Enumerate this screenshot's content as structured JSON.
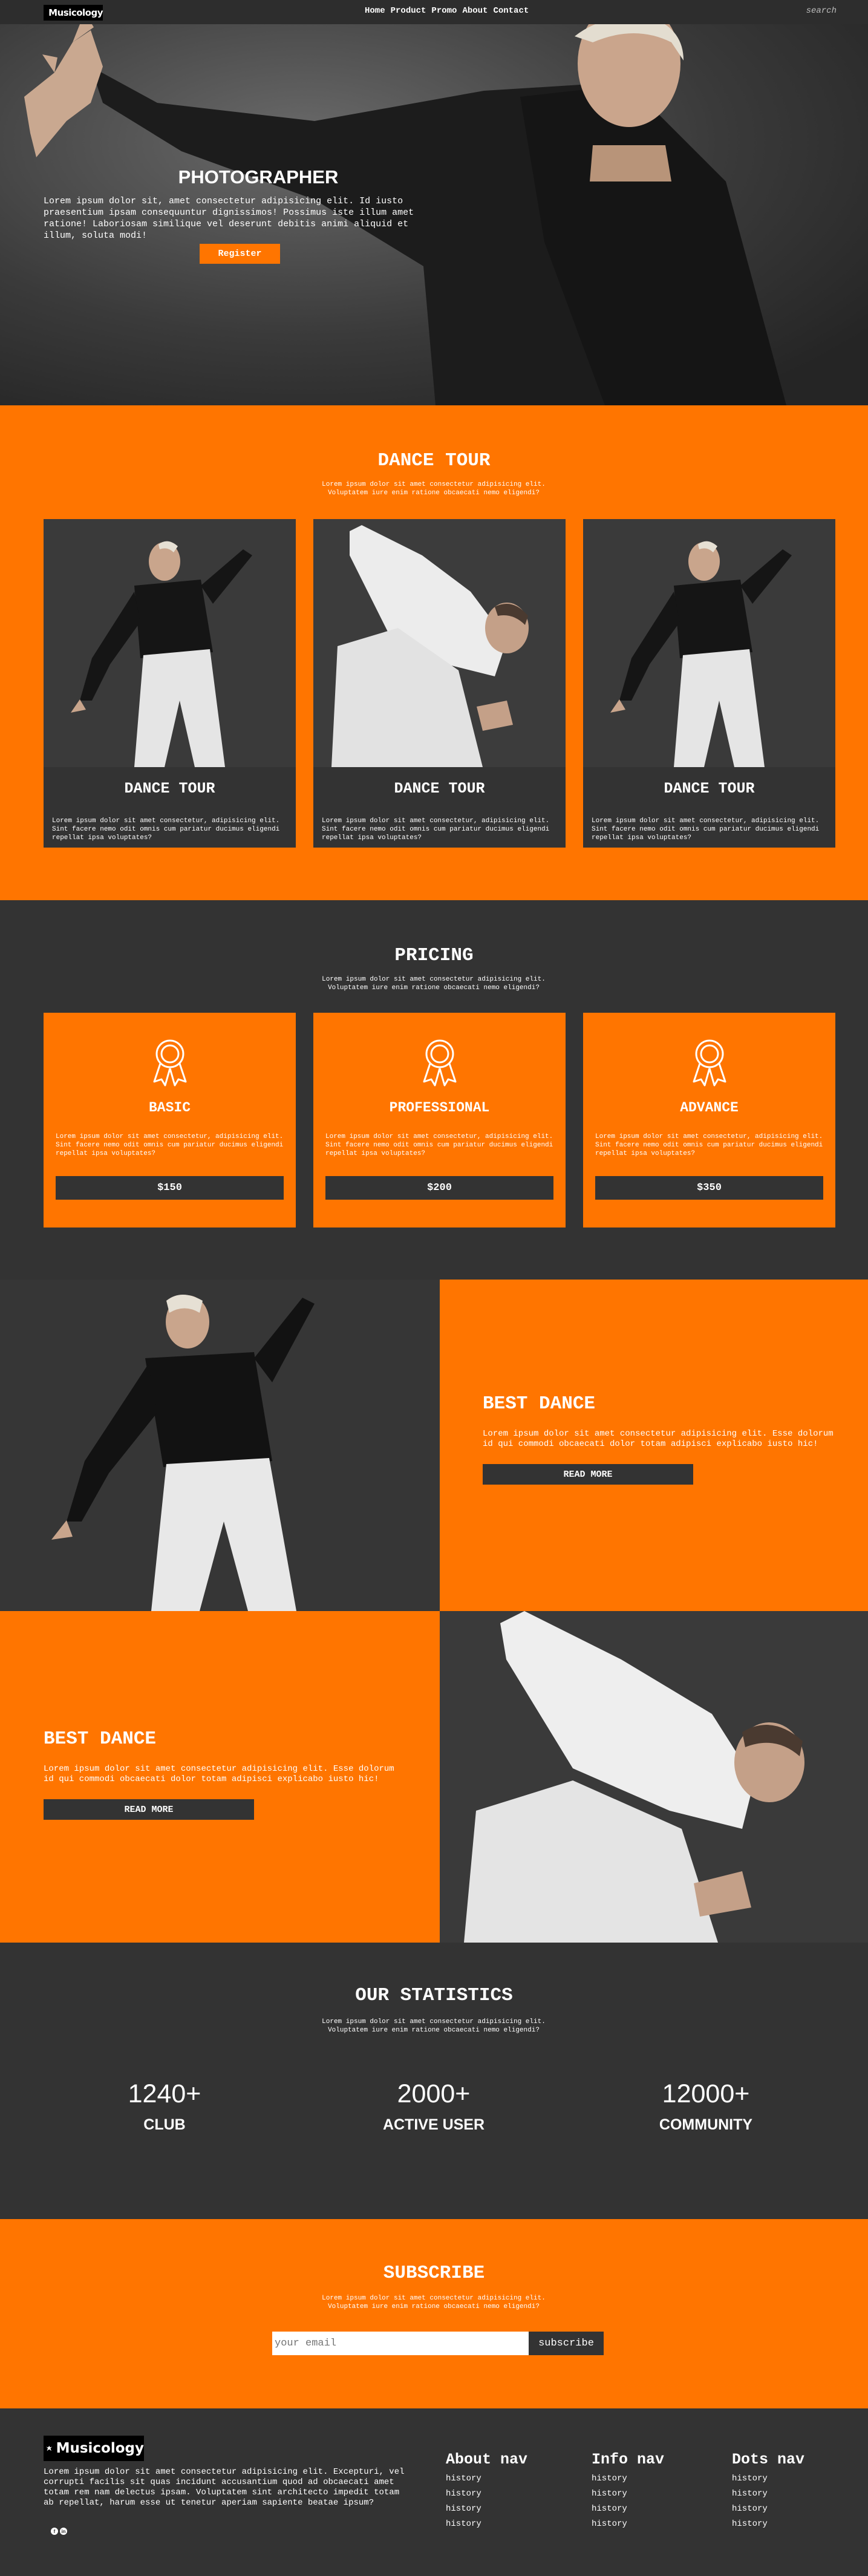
{
  "nav": {
    "logo_text": "Musicology",
    "links": [
      "Home",
      "Product",
      "Promo",
      "About",
      "Contact"
    ],
    "search": "search"
  },
  "hero": {
    "title": "PHOTOGRAPHER",
    "text": "Lorem ipsum dolor sit, amet consectetur adipisicing elit. Id iusto praesentium ipsam consequuntur dignissimos! Possimus iste illum amet ratione! Laboriosam similique vel deserunt debitis animi aliquid et illum, soluta modi!",
    "button": "Register"
  },
  "tour": {
    "title": "DANCE TOUR",
    "subtitle": "Lorem ipsum dolor sit amet consectetur adipisicing elit. Voluptatem iure enim ratione obcaecati nemo eligendi?",
    "cards": [
      {
        "title": "DANCE TOUR",
        "text": "Lorem ipsum dolor sit amet consectetur, adipisicing elit. Sint facere nemo odit omnis cum pariatur ducimus eligendi repellat ipsa voluptates?"
      },
      {
        "title": "DANCE TOUR",
        "text": "Lorem ipsum dolor sit amet consectetur, adipisicing elit. Sint facere nemo odit omnis cum pariatur ducimus eligendi repellat ipsa voluptates?"
      },
      {
        "title": "DANCE TOUR",
        "text": "Lorem ipsum dolor sit amet consectetur, adipisicing elit. Sint facere nemo odit omnis cum pariatur ducimus eligendi repellat ipsa voluptates?"
      }
    ]
  },
  "pricing": {
    "title": "PRICING",
    "subtitle": "Lorem ipsum dolor sit amet consectetur adipisicing elit. Voluptatem iure enim ratione obcaecati nemo eligendi?",
    "plans": [
      {
        "name": "BASIC",
        "text": "Lorem ipsum dolor sit amet consectetur, adipisicing elit. Sint facere nemo odit omnis cum pariatur ducimus eligendi repellat ipsa voluptates?",
        "price": "$150"
      },
      {
        "name": "PROFESSIONAL",
        "text": "Lorem ipsum dolor sit amet consectetur, adipisicing elit. Sint facere nemo odit omnis cum pariatur ducimus eligendi repellat ipsa voluptates?",
        "price": "$200"
      },
      {
        "name": "ADVANCE",
        "text": "Lorem ipsum dolor sit amet consectetur, adipisicing elit. Sint facere nemo odit omnis cum pariatur ducimus eligendi repellat ipsa voluptates?",
        "price": "$350"
      }
    ]
  },
  "features": [
    {
      "title": "BEST DANCE",
      "text": "Lorem ipsum dolor sit amet consectetur adipisicing elit. Esse dolorum id qui commodi obcaecati dolor totam adipisci explicabo iusto hic!",
      "button": "READ MORE"
    },
    {
      "title": "BEST DANCE",
      "text": "Lorem ipsum dolor sit amet consectetur adipisicing elit. Esse dolorum id qui commodi obcaecati dolor totam adipisci explicabo iusto hic!",
      "button": "READ MORE"
    }
  ],
  "stats": {
    "title": "OUR STATISTICS",
    "subtitle": "Lorem ipsum dolor sit amet consectetur adipisicing elit. Voluptatem iure enim ratione obcaecati nemo eligendi?",
    "items": [
      {
        "number": "1240+",
        "label": "CLUB"
      },
      {
        "number": "2000+",
        "label": "ACTIVE USER"
      },
      {
        "number": "12000+",
        "label": "COMMUNITY"
      }
    ]
  },
  "subscribe": {
    "title": "SUBSCRIBE",
    "subtitle": "Lorem ipsum dolor sit amet consectetur adipisicing elit. Voluptatem iure enim ratione obcaecati nemo eligendi?",
    "placeholder": "your email",
    "button": "subscribe"
  },
  "footer": {
    "logo_text": "Musicology",
    "about": "Lorem ipsum dolor sit amet consectetur adipisicing elit. Excepturi, vel corrupti facilis sit quas incidunt accusantium quod ad obcaecati amet totam rem nam delectus ipsam. Voluptatem sint architecto impedit totam ab repellat, harum esse ut tenetur aperiam sapiente beatae ipsum?",
    "social": [
      "f",
      "in"
    ],
    "columns": [
      {
        "title": "About nav",
        "links": [
          "history",
          "history",
          "history",
          "history"
        ]
      },
      {
        "title": "Info nav",
        "links": [
          "history",
          "history",
          "history",
          "history"
        ]
      },
      {
        "title": "Dots nav",
        "links": [
          "history",
          "history",
          "history",
          "history"
        ]
      }
    ]
  },
  "colors": {
    "accent": "#ff7500",
    "dark": "#333333",
    "nav": "#2d2d2d"
  }
}
